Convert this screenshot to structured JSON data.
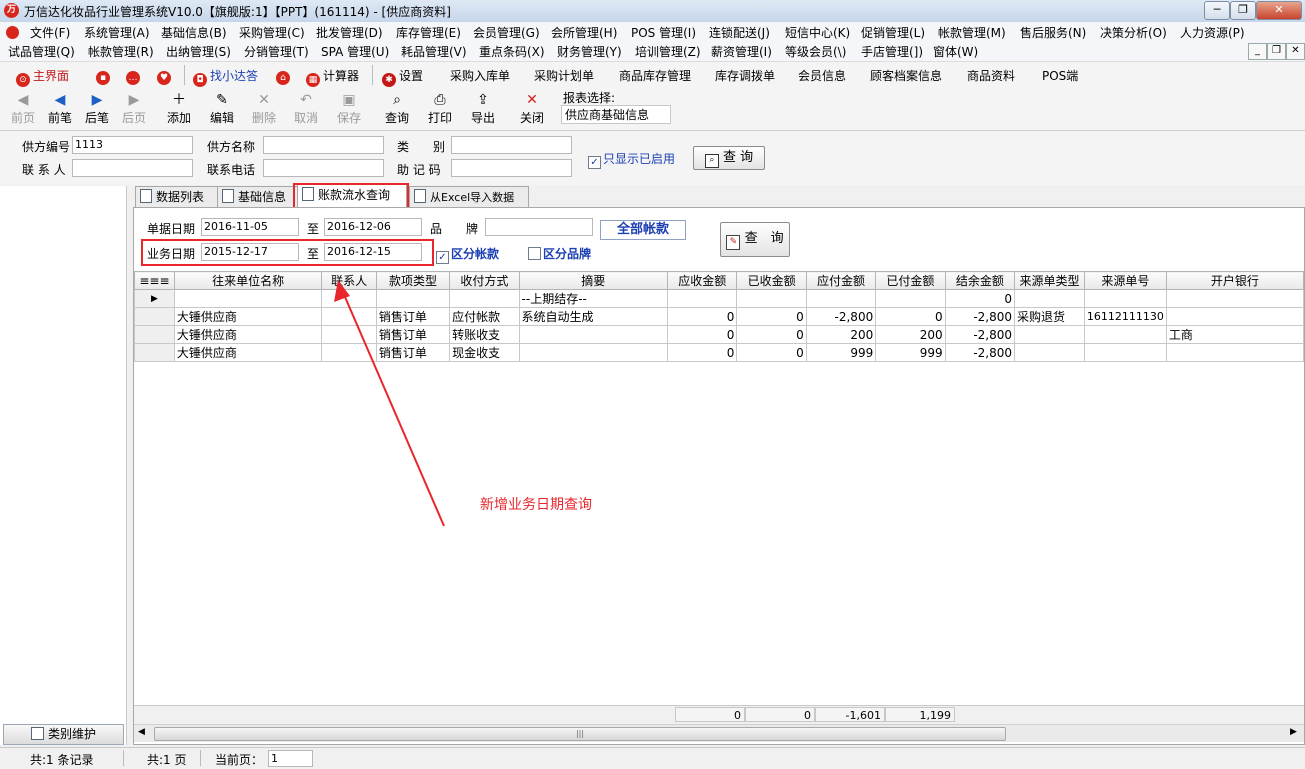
{
  "window": {
    "title": "万信达化妆品行业管理系统V10.0【旗舰版:1】【PPT】(161114) - [供应商资料]",
    "logo_text": "万"
  },
  "menu_row1": [
    "文件(F)",
    "系统管理(A)",
    "基础信息(B)",
    "采购管理(C)",
    "批发管理(D)",
    "库存管理(E)",
    "会员管理(G)",
    "会所管理(H)",
    "POS 管理(I)",
    "连锁配送(J)",
    "短信中心(K)",
    "促销管理(L)",
    "帐款管理(M)",
    "售后服务(N)",
    "决策分析(O)",
    "人力资源(P)"
  ],
  "menu_row2": [
    "试品管理(Q)",
    "帐款管理(R)",
    "出纳管理(S)",
    "分销管理(T)",
    "SPA 管理(U)",
    "耗品管理(V)",
    "重点条码(X)",
    "财务管理(Y)",
    "培训管理(Z)",
    "薪资管理(I)",
    "等级会员(\\)",
    "手店管理(])",
    "窗体(W)"
  ],
  "quickbar": {
    "home": "主界面",
    "assistant": "找小达答",
    "calculator": "计算器",
    "settings": "设置",
    "links": [
      "采购入库单",
      "采购计划单",
      "商品库存管理",
      "库存调拨单",
      "会员信息",
      "顾客档案信息",
      "商品资料",
      "POS端"
    ]
  },
  "toolbar": {
    "buttons": [
      {
        "label": "前页",
        "enabled": false
      },
      {
        "label": "前笔",
        "enabled": true
      },
      {
        "label": "后笔",
        "enabled": true
      },
      {
        "label": "后页",
        "enabled": false
      },
      {
        "label": "添加",
        "enabled": true
      },
      {
        "label": "编辑",
        "enabled": true
      },
      {
        "label": "删除",
        "enabled": false
      },
      {
        "label": "取消",
        "enabled": false
      },
      {
        "label": "保存",
        "enabled": false
      },
      {
        "label": "查询",
        "enabled": true
      },
      {
        "label": "打印",
        "enabled": true
      },
      {
        "label": "导出",
        "enabled": true
      },
      {
        "label": "关闭",
        "enabled": true
      }
    ],
    "report_label": "报表选择:",
    "report_value": "供应商基础信息"
  },
  "filter": {
    "supplier_code_label": "供方编号",
    "supplier_code_value": "1113",
    "supplier_name_label": "供方名称",
    "supplier_name_value": "",
    "category_label": "类　　别",
    "category_value": "",
    "contact_label": "联 系 人",
    "contact_value": "",
    "phone_label": "联系电话",
    "phone_value": "",
    "mnemonic_label": "助 记 码",
    "mnemonic_value": "",
    "only_enabled_label": "只显示已启用",
    "only_enabled_checked": true,
    "query_label": "查 询"
  },
  "tabs": [
    "数据列表",
    "基础信息",
    "账款流水查询",
    "从Excel导入数据"
  ],
  "active_tab": 2,
  "ledger": {
    "doc_date_label": "单据日期",
    "doc_date_from": "2016-11-05",
    "to_label": "至",
    "doc_date_to": "2016-12-06",
    "brand_label": "品　　牌",
    "brand_value": "",
    "all_accounts_label": "全部帐款",
    "biz_date_label": "业务日期",
    "biz_date_from": "2015-12-17",
    "biz_date_to": "2016-12-15",
    "split_account_label": "区分帐款",
    "split_account_checked": true,
    "split_brand_label": "区分品牌",
    "split_brand_checked": false,
    "query_label": "查　询"
  },
  "grid": {
    "columns": [
      "往来单位名称",
      "联系人",
      "款项类型",
      "收付方式",
      "摘要",
      "应收金额",
      "已收金额",
      "应付金额",
      "已付金额",
      "结余金额",
      "来源单类型",
      "来源单号",
      "开户银行"
    ],
    "rows": [
      [
        "",
        "",
        "",
        "",
        "--上期结存--",
        "",
        "",
        "",
        "",
        "0",
        "",
        "",
        ""
      ],
      [
        "大锤供应商",
        "",
        "销售订单",
        "应付帐款",
        "系统自动生成",
        "0",
        "0",
        "-2,800",
        "0",
        "-2,800",
        "采购退货",
        "16112111130",
        ""
      ],
      [
        "大锤供应商",
        "",
        "销售订单",
        "转账收支",
        "",
        "0",
        "0",
        "200",
        "200",
        "-2,800",
        "",
        "",
        "工商"
      ],
      [
        "大锤供应商",
        "",
        "销售订单",
        "现金收支",
        "",
        "0",
        "0",
        "999",
        "999",
        "-2,800",
        "",
        "",
        ""
      ]
    ],
    "totals": [
      "0",
      "0",
      "-1,601",
      "1,199"
    ]
  },
  "left_panel": {
    "category_button": "类别维护"
  },
  "status": {
    "records": "共:1 条记录",
    "pages": "共:1 页",
    "current_page_label": "当前页：",
    "current_page": "1"
  },
  "annotation": "新增业务日期查询",
  "colors": {
    "highlight": "#e8262b",
    "link_blue": "#1c3fb3",
    "brand_red": "#d8261c"
  }
}
